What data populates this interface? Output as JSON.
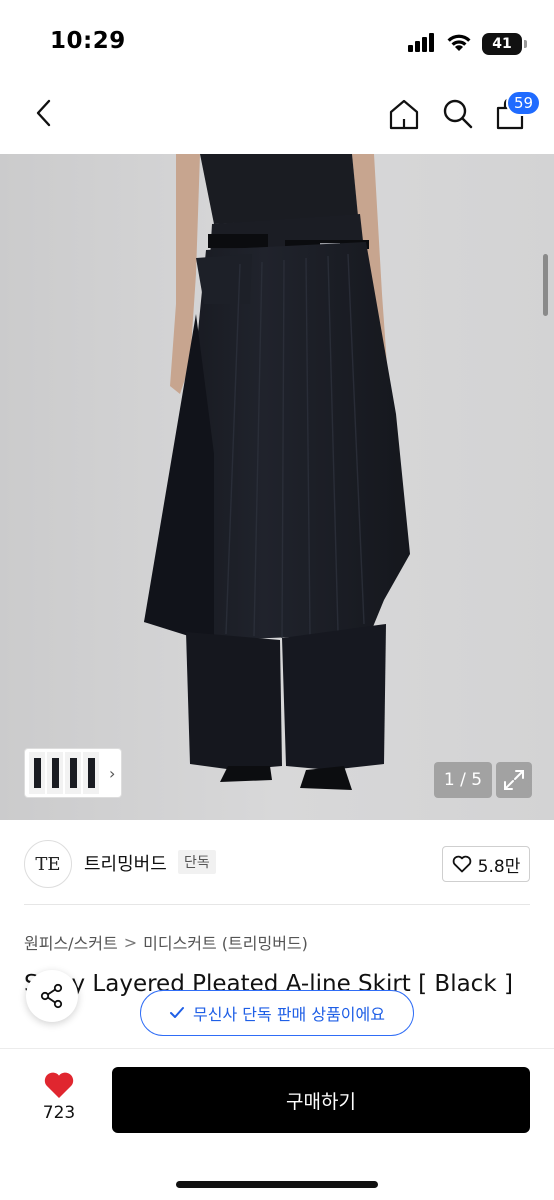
{
  "status_bar": {
    "time": "10:29",
    "battery": "41",
    "icons": [
      "cellular-signal-icon",
      "wifi-icon",
      "battery-icon"
    ]
  },
  "nav": {
    "icons": [
      "chevron-left-icon",
      "home-icon",
      "search-icon",
      "cart-icon"
    ],
    "cart_count": "59"
  },
  "gallery": {
    "counter": "1 / 5",
    "thumb_arrow": "›"
  },
  "brand": {
    "logo_text": "TE",
    "name": "트리밍버드",
    "tag": "단독",
    "like_count": "5.8만"
  },
  "breadcrumb": {
    "category": "원피스/스커트",
    "separator": ">",
    "subcategory": "미디스커트 (트리밍버드)"
  },
  "product": {
    "title": "Sway Layered Pleated A-line Skirt [ Black ]"
  },
  "exclusive_banner": {
    "text": "무신사 단독 판매 상품이에요"
  },
  "bottom": {
    "like_count": "723",
    "buy_label": "구매하기"
  },
  "colors": {
    "accent_blue": "#1f6bff",
    "heart_red": "#e0262f",
    "buy_button": "#000000"
  }
}
